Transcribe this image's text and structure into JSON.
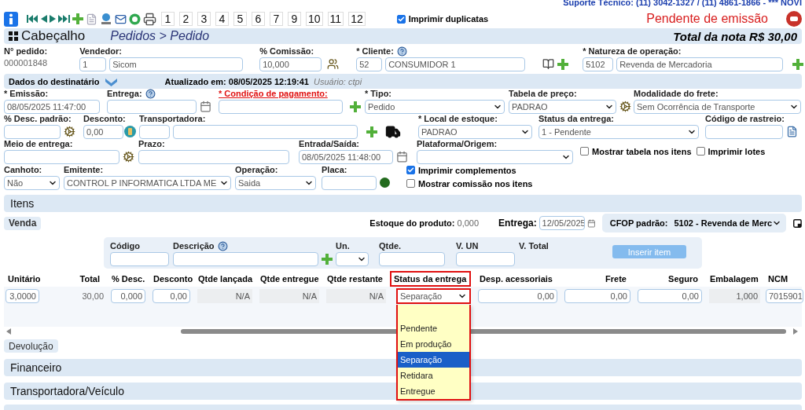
{
  "support_line": "Suporte Técnico: (11) 3042-1327 / (11) 4861-1866 - *** NOVI",
  "toolbar": {
    "pages": [
      "1",
      "2",
      "3",
      "4",
      "5",
      "6",
      "7",
      "9",
      "10",
      "11",
      "12"
    ],
    "print_duplicates": {
      "label": "Imprimir duplicatas",
      "checked": true
    },
    "status": "Pendente de emissão"
  },
  "header": {
    "title": "Cabeçalho",
    "breadcrumb": "Pedidos > Pedido",
    "total": "Total da nota R$ 30,00"
  },
  "order": {
    "number_label": "N° pedido:",
    "number": "000001848",
    "seller": {
      "label": "Vendedor:",
      "code": "1",
      "value": "Sicom"
    },
    "commission": {
      "label": "% Comissão:",
      "value": "10,000"
    },
    "client": {
      "label": "* Cliente:",
      "code": "52",
      "value": "CONSUMIDOR 1"
    },
    "nature": {
      "label": "* Natureza de operação:",
      "code": "5102",
      "value": "Revenda de Mercadoria"
    }
  },
  "recipient_bar": {
    "title": "Dados do destinatário",
    "updated": "Atualizado em: 08/05/2025 12:19:41",
    "user": "Usuário: ctpi"
  },
  "form": {
    "issue": {
      "label": "* Emissão:",
      "value": "08/05/2025 11:47:00"
    },
    "delivery": {
      "label": "Entrega:"
    },
    "payment": {
      "label": "* Condição de pagamento:"
    },
    "type": {
      "label": "* Tipo:",
      "value": "Pedido"
    },
    "price_table": {
      "label": "Tabela de preço:",
      "value": "PADRAO"
    },
    "freight": {
      "label": "Modalidade do frete:",
      "value": "Sem Ocorrência de Transporte"
    },
    "default_discount": {
      "label": "% Desc. padrão:"
    },
    "discount": {
      "label": "Desconto:",
      "value": "0,00"
    },
    "carrier": {
      "label": "Transportadora:"
    },
    "stock_location": {
      "label": "* Local de estoque:",
      "value": "PADRAO"
    },
    "delivery_status": {
      "label": "Status da entrega:",
      "value": "1 - Pendente"
    },
    "tracking": {
      "label": "Código de rastreio:"
    },
    "delivery_method": {
      "label": "Meio de entrega:"
    },
    "term": {
      "label": "Prazo:"
    },
    "in_out": {
      "label": "Entrada/Saída:",
      "value": "08/05/2025 11:48:00"
    },
    "platform": {
      "label": "Plataforma/Origem:"
    },
    "stub": {
      "label": "Canhoto:",
      "value": "Não"
    },
    "issuer": {
      "label": "Emitente:",
      "value": "CONTROL P INFORMATICA LTDA ME"
    },
    "operation": {
      "label": "Operação:",
      "value": "Saida"
    },
    "plate": {
      "label": "Placa:"
    }
  },
  "options": [
    {
      "label": "Mostrar tabela nos itens",
      "checked": false
    },
    {
      "label": "Imprimir lotes",
      "checked": false
    },
    {
      "label": "Imprimir complementos",
      "checked": true
    },
    {
      "label": "Mostrar comissão nos itens",
      "checked": false
    }
  ],
  "items": {
    "title": "Itens",
    "tab": "Venda",
    "stock_label": "Estoque do produto:",
    "stock_value": "0,000",
    "delivery_label": "Entrega:",
    "delivery_date": "12/05/2025",
    "cfop_label": "CFOP padrão:",
    "cfop_value": "5102 - Revenda de Merc",
    "entry": {
      "code": "Código",
      "description": "Descrição",
      "unit": "Un.",
      "qty": "Qtde.",
      "unit_price": "V. UN",
      "total": "V. Total",
      "insert_button": "Inserir item",
      "insert_disabled": true
    },
    "columns": [
      {
        "label": "Unitário",
        "highlighted": false
      },
      {
        "label": "Total",
        "highlighted": false
      },
      {
        "label": "% Desc.",
        "highlighted": false
      },
      {
        "label": "Desconto",
        "highlighted": false
      },
      {
        "label": "Qtde lançada",
        "highlighted": false
      },
      {
        "label": "Qtde entregue",
        "highlighted": false
      },
      {
        "label": "Qtde restante",
        "highlighted": false
      },
      {
        "label": "Status da entrega",
        "highlighted": true
      },
      {
        "label": "Desp. acessoriais",
        "highlighted": false
      },
      {
        "label": "Frete",
        "highlighted": false
      },
      {
        "label": "Seguro",
        "highlighted": false
      },
      {
        "label": "Embalagem",
        "highlighted": false
      },
      {
        "label": "NCM",
        "highlighted": false
      }
    ],
    "rows": [
      {
        "cells": [
          {
            "kind": "input",
            "value": "3,0000"
          },
          {
            "kind": "text",
            "value": "30,00"
          },
          {
            "kind": "input",
            "value": "0,000"
          },
          {
            "kind": "input",
            "value": "0,00"
          },
          {
            "kind": "readonly",
            "value": "N/A"
          },
          {
            "kind": "readonly",
            "value": "N/A"
          },
          {
            "kind": "readonly",
            "value": "N/A"
          },
          {
            "kind": "select",
            "value": "Separação",
            "open": true
          },
          {
            "kind": "input",
            "value": "0,00"
          },
          {
            "kind": "input",
            "value": "0,00"
          },
          {
            "kind": "input",
            "value": "0,00"
          },
          {
            "kind": "readonly",
            "value": "1,000"
          },
          {
            "kind": "input",
            "value": "7015901"
          }
        ]
      }
    ],
    "status_options": [
      {
        "label": "Pendente",
        "selected": false
      },
      {
        "label": "Em produção",
        "selected": false
      },
      {
        "label": "Separação",
        "selected": true
      },
      {
        "label": "Retidara",
        "selected": false
      },
      {
        "label": "Entregue",
        "selected": false
      }
    ],
    "return_tab": "Devolução"
  },
  "sections": [
    "Financeiro",
    "Transportadora/Veículo"
  ]
}
